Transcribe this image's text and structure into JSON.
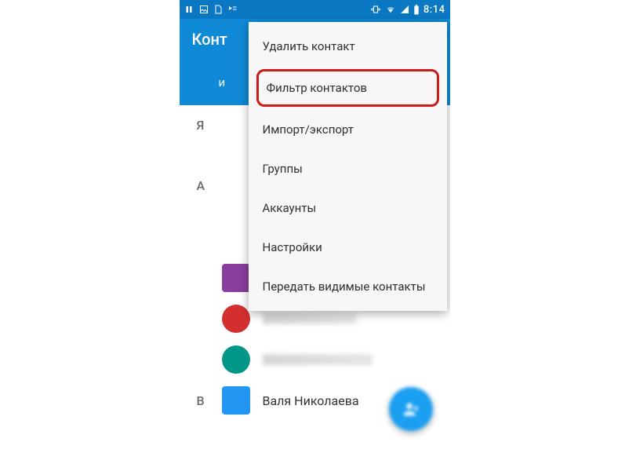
{
  "status": {
    "time": "8:14"
  },
  "header": {
    "title": "Конт",
    "partial_text": "и"
  },
  "menu": {
    "items": [
      {
        "label": "Удалить контакт",
        "highlighted": false
      },
      {
        "label": "Фильтр контактов",
        "highlighted": true
      },
      {
        "label": "Импорт/экспорт",
        "highlighted": false
      },
      {
        "label": "Группы",
        "highlighted": false
      },
      {
        "label": "Аккаунты",
        "highlighted": false
      },
      {
        "label": "Настройки",
        "highlighted": false
      },
      {
        "label": "Передать видимые контакты",
        "highlighted": false
      }
    ]
  },
  "sections": [
    {
      "letter": "Я"
    },
    {
      "letter": "А"
    },
    {
      "letter": "B"
    }
  ],
  "contacts": [
    {
      "avatar_color": "violet",
      "name_visible": ""
    },
    {
      "avatar_color": "red",
      "name_visible": ""
    },
    {
      "avatar_color": "teal",
      "name_visible": ""
    },
    {
      "avatar_color": "blue",
      "name_visible": "Валя Николаева"
    }
  ],
  "colors": {
    "status_bar": "#0a78c2",
    "app_bar": "#1089d6",
    "highlight_border": "#cc1b1b",
    "fab": "#1a9ff1"
  }
}
